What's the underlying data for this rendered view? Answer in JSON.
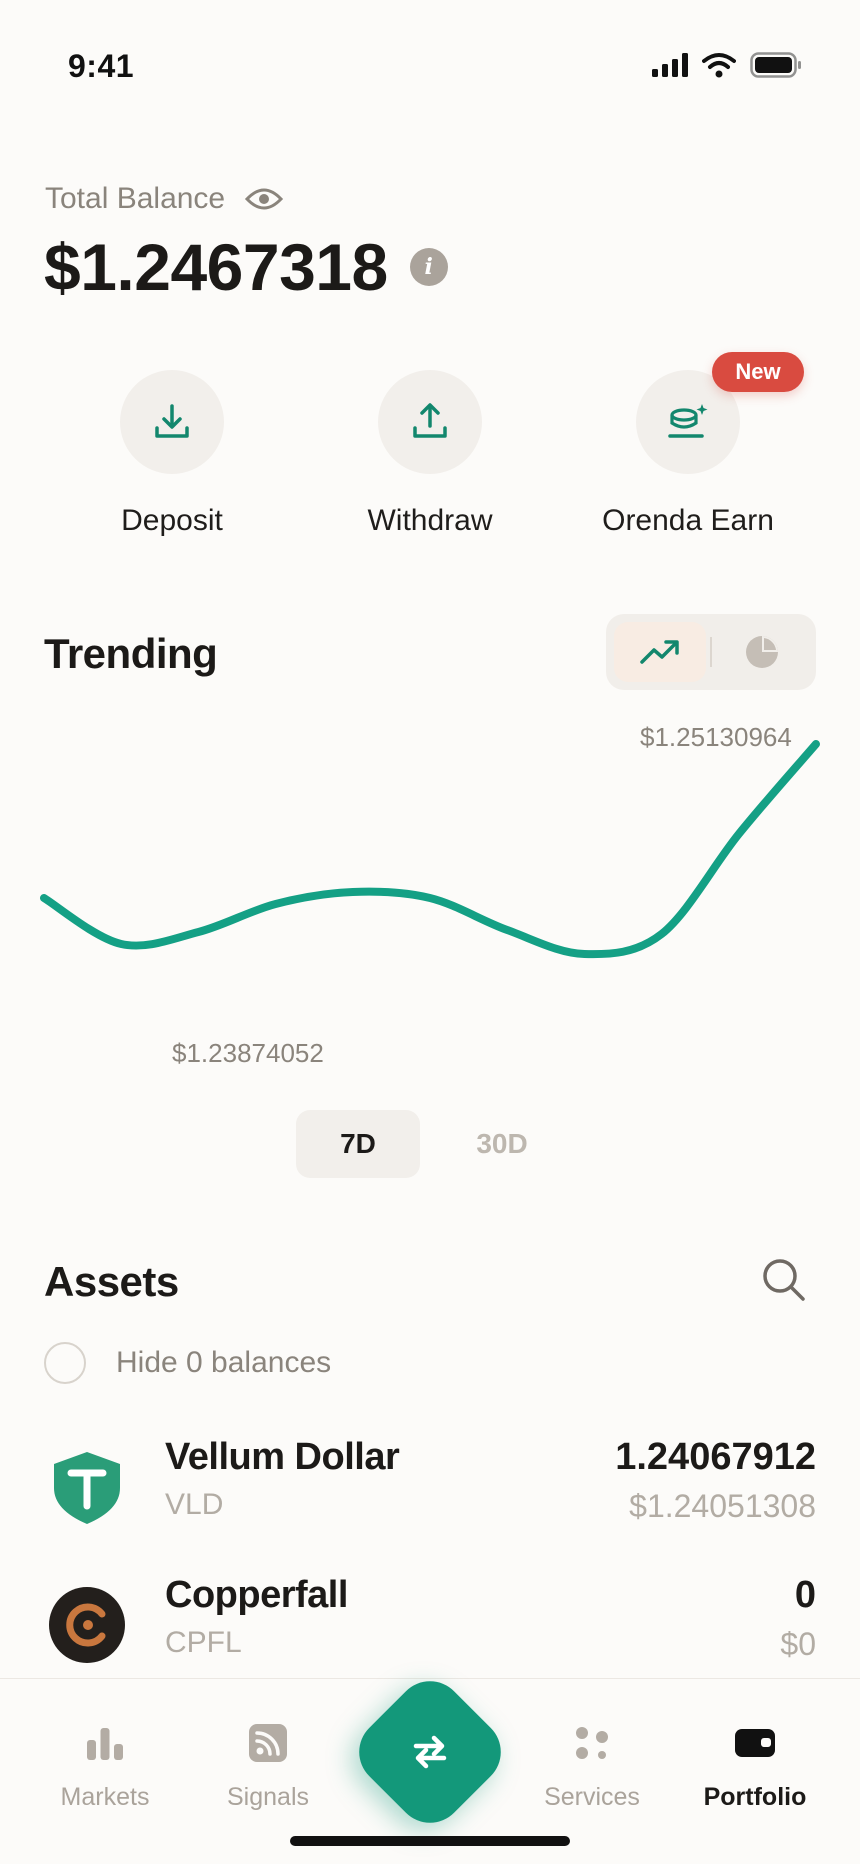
{
  "status_bar": {
    "time": "9:41"
  },
  "balance": {
    "label": "Total Balance",
    "value": "$1.2467318",
    "info_glyph": "i"
  },
  "actions": [
    {
      "label": "Deposit",
      "icon": "download-icon"
    },
    {
      "label": "Withdraw",
      "icon": "upload-icon"
    },
    {
      "label": "Orenda Earn",
      "icon": "coins-sparkle-icon",
      "badge": "New"
    }
  ],
  "trending": {
    "title": "Trending",
    "view_toggle": [
      {
        "icon": "trend-line-icon",
        "active": true
      },
      {
        "icon": "pie-chart-icon",
        "active": false
      }
    ],
    "periods": [
      {
        "label": "7D",
        "active": true
      },
      {
        "label": "30D",
        "active": false
      }
    ]
  },
  "chart_data": {
    "type": "line",
    "annotations": {
      "max": "$1.25130964",
      "min": "$1.23874052"
    },
    "series": [
      {
        "values": [
          1.2436,
          1.2413,
          1.2419,
          1.2433,
          1.2439,
          1.2436,
          1.242,
          1.2408,
          1.2418,
          1.2468,
          1.2513
        ]
      }
    ],
    "ylim": [
      1.238,
      1.252
    ],
    "grid": false,
    "color": "#14a085"
  },
  "assets": {
    "title": "Assets",
    "hide_zero_label": "Hide 0 balances",
    "items": [
      {
        "name": "Vellum Dollar",
        "symbol": "VLD",
        "amount": "1.24067912",
        "value": "$1.24051308",
        "icon": "tether-icon",
        "color": "#2a9d78"
      },
      {
        "name": "Copperfall",
        "symbol": "CPFL",
        "amount": "0",
        "value": "$0",
        "icon": "copperfall-icon",
        "color": "#c9773e"
      }
    ]
  },
  "nav": {
    "items": [
      {
        "label": "Markets",
        "icon": "bar-chart-icon",
        "active": false
      },
      {
        "label": "Signals",
        "icon": "rss-icon",
        "active": false
      },
      {
        "label": "Services",
        "icon": "dots-icon",
        "active": false
      },
      {
        "label": "Portfolio",
        "icon": "wallet-icon",
        "active": true
      }
    ],
    "center_icon": "swap-icon"
  },
  "colors": {
    "accent": "#13987a",
    "badge": "#d94b40",
    "muted": "#8a847c"
  }
}
